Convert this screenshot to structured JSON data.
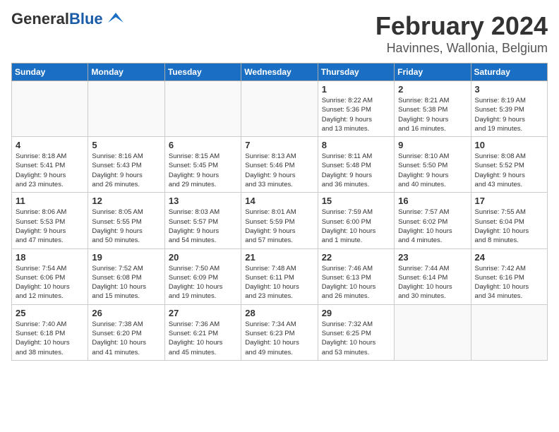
{
  "header": {
    "logo_general": "General",
    "logo_blue": "Blue",
    "month_year": "February 2024",
    "location": "Havinnes, Wallonia, Belgium"
  },
  "weekdays": [
    "Sunday",
    "Monday",
    "Tuesday",
    "Wednesday",
    "Thursday",
    "Friday",
    "Saturday"
  ],
  "weeks": [
    [
      {
        "day": "",
        "info": ""
      },
      {
        "day": "",
        "info": ""
      },
      {
        "day": "",
        "info": ""
      },
      {
        "day": "",
        "info": ""
      },
      {
        "day": "1",
        "info": "Sunrise: 8:22 AM\nSunset: 5:36 PM\nDaylight: 9 hours\nand 13 minutes."
      },
      {
        "day": "2",
        "info": "Sunrise: 8:21 AM\nSunset: 5:38 PM\nDaylight: 9 hours\nand 16 minutes."
      },
      {
        "day": "3",
        "info": "Sunrise: 8:19 AM\nSunset: 5:39 PM\nDaylight: 9 hours\nand 19 minutes."
      }
    ],
    [
      {
        "day": "4",
        "info": "Sunrise: 8:18 AM\nSunset: 5:41 PM\nDaylight: 9 hours\nand 23 minutes."
      },
      {
        "day": "5",
        "info": "Sunrise: 8:16 AM\nSunset: 5:43 PM\nDaylight: 9 hours\nand 26 minutes."
      },
      {
        "day": "6",
        "info": "Sunrise: 8:15 AM\nSunset: 5:45 PM\nDaylight: 9 hours\nand 29 minutes."
      },
      {
        "day": "7",
        "info": "Sunrise: 8:13 AM\nSunset: 5:46 PM\nDaylight: 9 hours\nand 33 minutes."
      },
      {
        "day": "8",
        "info": "Sunrise: 8:11 AM\nSunset: 5:48 PM\nDaylight: 9 hours\nand 36 minutes."
      },
      {
        "day": "9",
        "info": "Sunrise: 8:10 AM\nSunset: 5:50 PM\nDaylight: 9 hours\nand 40 minutes."
      },
      {
        "day": "10",
        "info": "Sunrise: 8:08 AM\nSunset: 5:52 PM\nDaylight: 9 hours\nand 43 minutes."
      }
    ],
    [
      {
        "day": "11",
        "info": "Sunrise: 8:06 AM\nSunset: 5:53 PM\nDaylight: 9 hours\nand 47 minutes."
      },
      {
        "day": "12",
        "info": "Sunrise: 8:05 AM\nSunset: 5:55 PM\nDaylight: 9 hours\nand 50 minutes."
      },
      {
        "day": "13",
        "info": "Sunrise: 8:03 AM\nSunset: 5:57 PM\nDaylight: 9 hours\nand 54 minutes."
      },
      {
        "day": "14",
        "info": "Sunrise: 8:01 AM\nSunset: 5:59 PM\nDaylight: 9 hours\nand 57 minutes."
      },
      {
        "day": "15",
        "info": "Sunrise: 7:59 AM\nSunset: 6:00 PM\nDaylight: 10 hours\nand 1 minute."
      },
      {
        "day": "16",
        "info": "Sunrise: 7:57 AM\nSunset: 6:02 PM\nDaylight: 10 hours\nand 4 minutes."
      },
      {
        "day": "17",
        "info": "Sunrise: 7:55 AM\nSunset: 6:04 PM\nDaylight: 10 hours\nand 8 minutes."
      }
    ],
    [
      {
        "day": "18",
        "info": "Sunrise: 7:54 AM\nSunset: 6:06 PM\nDaylight: 10 hours\nand 12 minutes."
      },
      {
        "day": "19",
        "info": "Sunrise: 7:52 AM\nSunset: 6:08 PM\nDaylight: 10 hours\nand 15 minutes."
      },
      {
        "day": "20",
        "info": "Sunrise: 7:50 AM\nSunset: 6:09 PM\nDaylight: 10 hours\nand 19 minutes."
      },
      {
        "day": "21",
        "info": "Sunrise: 7:48 AM\nSunset: 6:11 PM\nDaylight: 10 hours\nand 23 minutes."
      },
      {
        "day": "22",
        "info": "Sunrise: 7:46 AM\nSunset: 6:13 PM\nDaylight: 10 hours\nand 26 minutes."
      },
      {
        "day": "23",
        "info": "Sunrise: 7:44 AM\nSunset: 6:14 PM\nDaylight: 10 hours\nand 30 minutes."
      },
      {
        "day": "24",
        "info": "Sunrise: 7:42 AM\nSunset: 6:16 PM\nDaylight: 10 hours\nand 34 minutes."
      }
    ],
    [
      {
        "day": "25",
        "info": "Sunrise: 7:40 AM\nSunset: 6:18 PM\nDaylight: 10 hours\nand 38 minutes."
      },
      {
        "day": "26",
        "info": "Sunrise: 7:38 AM\nSunset: 6:20 PM\nDaylight: 10 hours\nand 41 minutes."
      },
      {
        "day": "27",
        "info": "Sunrise: 7:36 AM\nSunset: 6:21 PM\nDaylight: 10 hours\nand 45 minutes."
      },
      {
        "day": "28",
        "info": "Sunrise: 7:34 AM\nSunset: 6:23 PM\nDaylight: 10 hours\nand 49 minutes."
      },
      {
        "day": "29",
        "info": "Sunrise: 7:32 AM\nSunset: 6:25 PM\nDaylight: 10 hours\nand 53 minutes."
      },
      {
        "day": "",
        "info": ""
      },
      {
        "day": "",
        "info": ""
      }
    ]
  ]
}
